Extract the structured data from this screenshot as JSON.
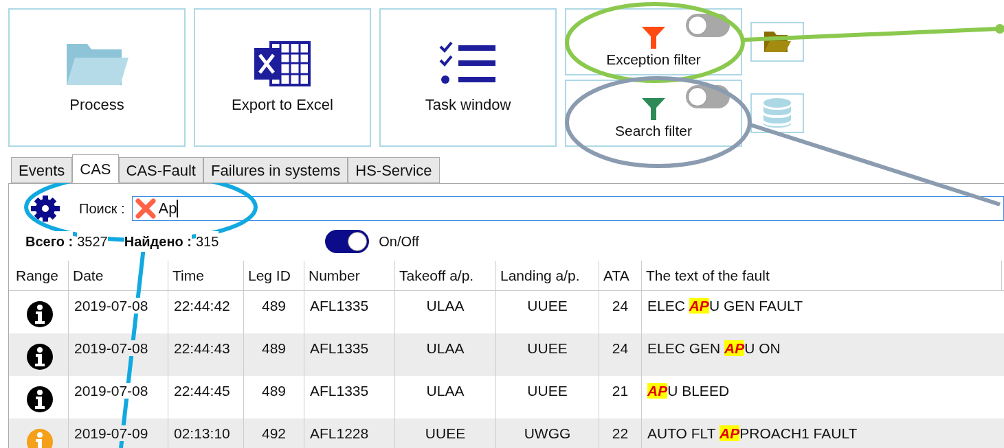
{
  "toolbar": {
    "buttons": [
      {
        "kind": "folder",
        "label": "Process"
      },
      {
        "kind": "excel",
        "label": "Export to Excel"
      },
      {
        "kind": "tasks",
        "label": "Task window"
      }
    ],
    "filters": [
      {
        "kind": "exception",
        "label": "Exception filter",
        "on": false
      },
      {
        "kind": "search",
        "label": "Search filter",
        "on": false
      }
    ],
    "side_buttons": [
      {
        "kind": "open-folder"
      },
      {
        "kind": "database"
      }
    ]
  },
  "tabs": [
    {
      "label": "Events",
      "selected": false
    },
    {
      "label": "CAS",
      "selected": true
    },
    {
      "label": "CAS-Fault",
      "selected": false
    },
    {
      "label": "Failures in systems",
      "selected": false
    },
    {
      "label": "HS-Service",
      "selected": false
    }
  ],
  "search": {
    "label": "Поиск :",
    "value": "Ap"
  },
  "counts": {
    "total_label": "Всего :",
    "total": "3527",
    "found_label": "Найдено :",
    "found": "315"
  },
  "toggle": {
    "label": "On/Off",
    "on": true
  },
  "table": {
    "columns": [
      "Range",
      "Date",
      "Time",
      "Leg ID",
      "Number",
      "Takeoff a/p.",
      "Landing a/p.",
      "ATA",
      "The text of the fault"
    ],
    "rows": [
      {
        "color": "#000000",
        "date": "2019-07-08",
        "time": "22:44:42",
        "leg_id": "489",
        "number": "AFL1335",
        "takeoff": "ULAA",
        "landing": "UUEE",
        "ata": "24",
        "fault": [
          {
            "text": "ELEC ",
            "highlight": false
          },
          {
            "text": "AP",
            "highlight": true
          },
          {
            "text": "U GEN FAULT",
            "highlight": false
          }
        ]
      },
      {
        "color": "#000000",
        "date": "2019-07-08",
        "time": "22:44:43",
        "leg_id": "489",
        "number": "AFL1335",
        "takeoff": "ULAA",
        "landing": "UUEE",
        "ata": "24",
        "fault": [
          {
            "text": "ELEC GEN ",
            "highlight": false
          },
          {
            "text": "AP",
            "highlight": true
          },
          {
            "text": "U ON",
            "highlight": false
          }
        ]
      },
      {
        "color": "#000000",
        "date": "2019-07-08",
        "time": "22:44:45",
        "leg_id": "489",
        "number": "AFL1335",
        "takeoff": "ULAA",
        "landing": "UUEE",
        "ata": "21",
        "fault": [
          {
            "text": "AP",
            "highlight": true
          },
          {
            "text": "U BLEED",
            "highlight": false
          }
        ]
      },
      {
        "color": "#f5a01a",
        "date": "2019-07-09",
        "time": "02:13:10",
        "leg_id": "492",
        "number": "AFL1228",
        "takeoff": "UUEE",
        "landing": "UWGG",
        "ata": "22",
        "fault": [
          {
            "text": "AUTO FLT ",
            "highlight": false
          },
          {
            "text": "AP",
            "highlight": true
          },
          {
            "text": "PROACH1 FAULT",
            "highlight": false
          }
        ]
      }
    ]
  },
  "annotations": [
    {
      "color": "#8bc94e"
    },
    {
      "color": "#8b9bb0"
    },
    {
      "color": "#12a9e0"
    }
  ]
}
